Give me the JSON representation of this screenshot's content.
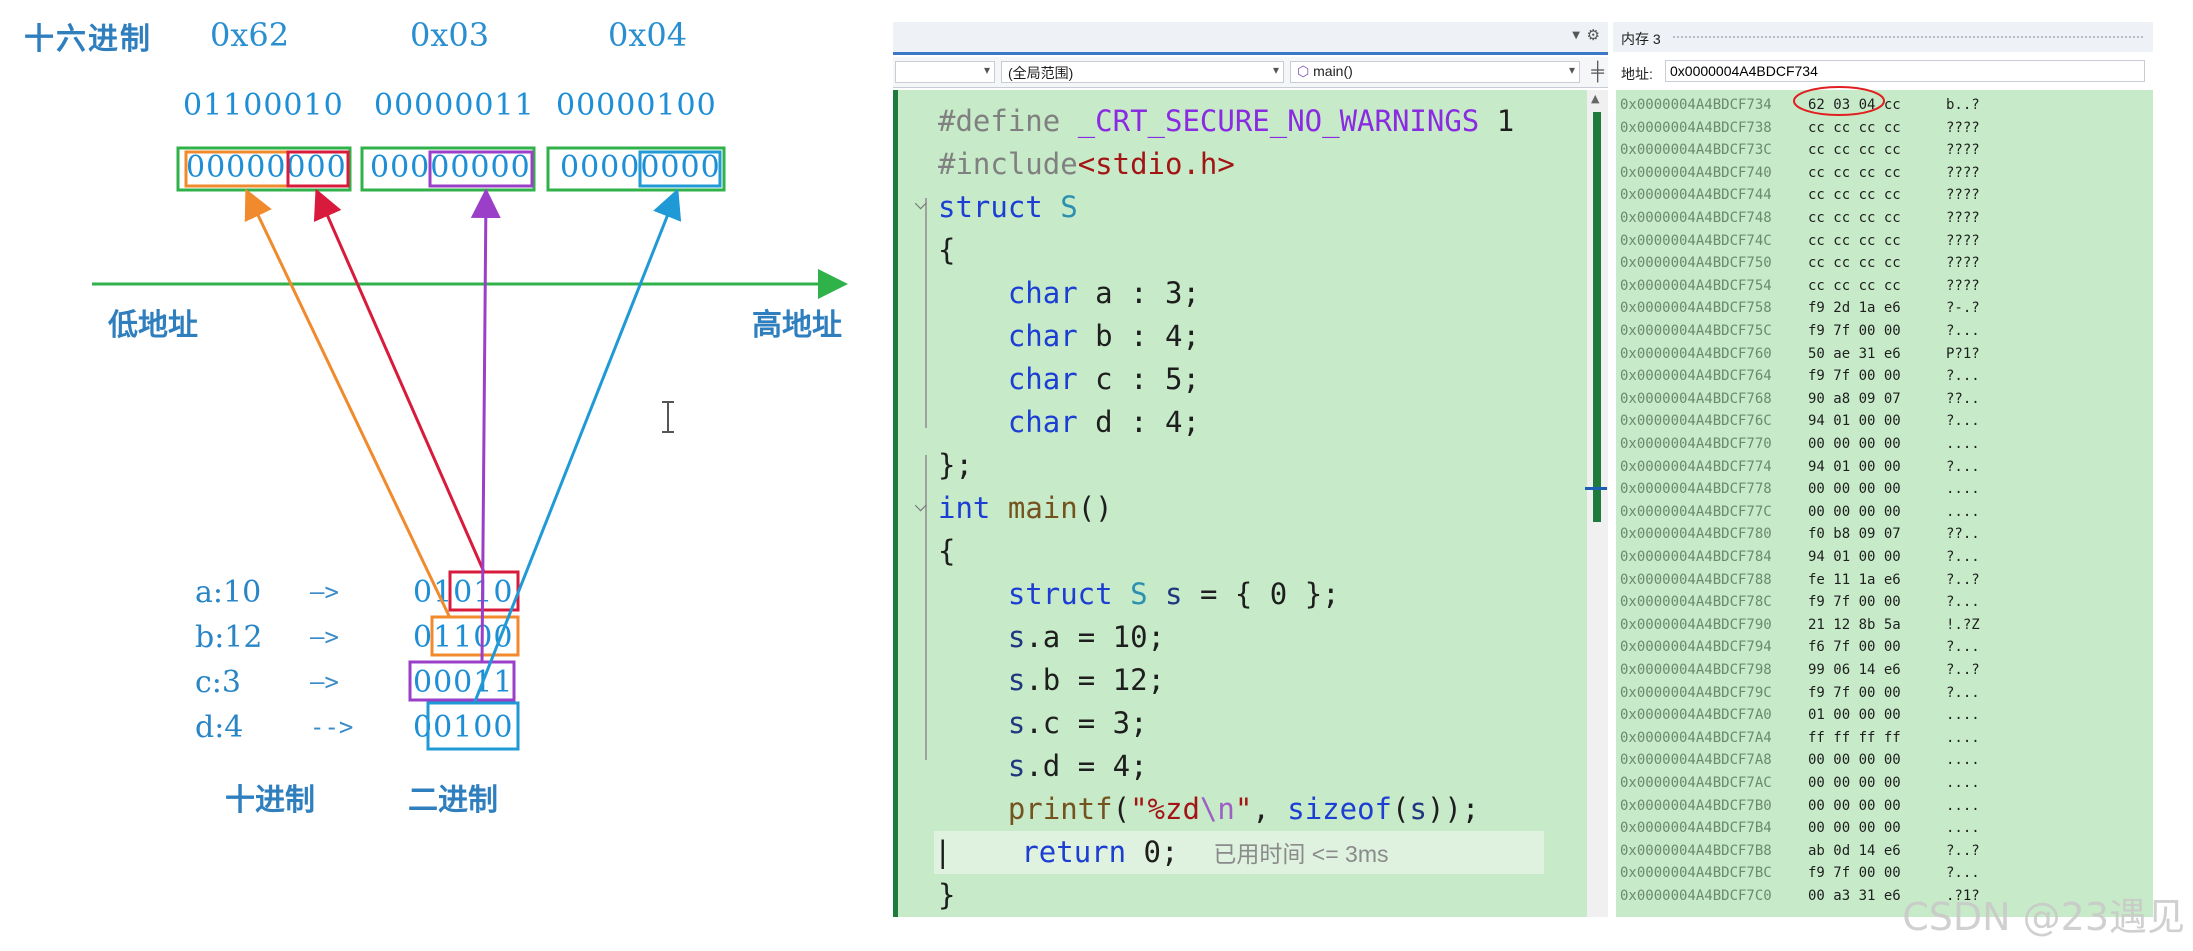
{
  "diagram": {
    "hex_label": "十六进制",
    "hex_values": [
      "0x62",
      "0x03",
      "0x04"
    ],
    "binary_values": [
      "01100010",
      "00000011",
      "00000100"
    ],
    "byte_boxes": [
      "00000000",
      "00000000",
      "00000000"
    ],
    "low_addr_label": "低地址",
    "high_addr_label": "高地址",
    "rows": [
      {
        "label": "a:10",
        "arrow": "—>",
        "bits": "01010"
      },
      {
        "label": "b:12",
        "arrow": "—>",
        "bits": "01100"
      },
      {
        "label": "c:3",
        "arrow": "—>",
        "bits": "00011"
      },
      {
        "label": "d:4",
        "arrow": "-->",
        "bits": "00100"
      }
    ],
    "decimal_label": "十进制",
    "binary_label": "二进制",
    "colors": {
      "green": "#2fb24a",
      "red": "#d81b3c",
      "orange": "#f08a2c",
      "purple": "#9b3fc8",
      "blue": "#1f9ad6"
    }
  },
  "editor": {
    "scope_dropdown": "(全局范围)",
    "function_dropdown": "main()",
    "elapsed_hint": "已用时间 <= 3ms"
  },
  "memory": {
    "title": "内存 3",
    "address_label": "地址:",
    "address_value": "0x0000004A4BDCF734",
    "rows": [
      {
        "addr": "0x0000004A4BDCF734",
        "bytes": "62 03 04 cc",
        "chars": "b..?"
      },
      {
        "addr": "0x0000004A4BDCF738",
        "bytes": "cc cc cc cc",
        "chars": "????"
      },
      {
        "addr": "0x0000004A4BDCF73C",
        "bytes": "cc cc cc cc",
        "chars": "????"
      },
      {
        "addr": "0x0000004A4BDCF740",
        "bytes": "cc cc cc cc",
        "chars": "????"
      },
      {
        "addr": "0x0000004A4BDCF744",
        "bytes": "cc cc cc cc",
        "chars": "????"
      },
      {
        "addr": "0x0000004A4BDCF748",
        "bytes": "cc cc cc cc",
        "chars": "????"
      },
      {
        "addr": "0x0000004A4BDCF74C",
        "bytes": "cc cc cc cc",
        "chars": "????"
      },
      {
        "addr": "0x0000004A4BDCF750",
        "bytes": "cc cc cc cc",
        "chars": "????"
      },
      {
        "addr": "0x0000004A4BDCF754",
        "bytes": "cc cc cc cc",
        "chars": "????"
      },
      {
        "addr": "0x0000004A4BDCF758",
        "bytes": "f9 2d 1a e6",
        "chars": "?-.?"
      },
      {
        "addr": "0x0000004A4BDCF75C",
        "bytes": "f9 7f 00 00",
        "chars": "?..."
      },
      {
        "addr": "0x0000004A4BDCF760",
        "bytes": "50 ae 31 e6",
        "chars": "P?1?"
      },
      {
        "addr": "0x0000004A4BDCF764",
        "bytes": "f9 7f 00 00",
        "chars": "?..."
      },
      {
        "addr": "0x0000004A4BDCF768",
        "bytes": "90 a8 09 07",
        "chars": "??.."
      },
      {
        "addr": "0x0000004A4BDCF76C",
        "bytes": "94 01 00 00",
        "chars": "?..."
      },
      {
        "addr": "0x0000004A4BDCF770",
        "bytes": "00 00 00 00",
        "chars": "...."
      },
      {
        "addr": "0x0000004A4BDCF774",
        "bytes": "94 01 00 00",
        "chars": "?..."
      },
      {
        "addr": "0x0000004A4BDCF778",
        "bytes": "00 00 00 00",
        "chars": "...."
      },
      {
        "addr": "0x0000004A4BDCF77C",
        "bytes": "00 00 00 00",
        "chars": "...."
      },
      {
        "addr": "0x0000004A4BDCF780",
        "bytes": "f0 b8 09 07",
        "chars": "??.."
      },
      {
        "addr": "0x0000004A4BDCF784",
        "bytes": "94 01 00 00",
        "chars": "?..."
      },
      {
        "addr": "0x0000004A4BDCF788",
        "bytes": "fe 11 1a e6",
        "chars": "?..?"
      },
      {
        "addr": "0x0000004A4BDCF78C",
        "bytes": "f9 7f 00 00",
        "chars": "?..."
      },
      {
        "addr": "0x0000004A4BDCF790",
        "bytes": "21 12 8b 5a",
        "chars": "!.?Z"
      },
      {
        "addr": "0x0000004A4BDCF794",
        "bytes": "f6 7f 00 00",
        "chars": "?..."
      },
      {
        "addr": "0x0000004A4BDCF798",
        "bytes": "99 06 14 e6",
        "chars": "?..?"
      },
      {
        "addr": "0x0000004A4BDCF79C",
        "bytes": "f9 7f 00 00",
        "chars": "?..."
      },
      {
        "addr": "0x0000004A4BDCF7A0",
        "bytes": "01 00 00 00",
        "chars": "...."
      },
      {
        "addr": "0x0000004A4BDCF7A4",
        "bytes": "ff ff ff ff",
        "chars": "...."
      },
      {
        "addr": "0x0000004A4BDCF7A8",
        "bytes": "00 00 00 00",
        "chars": "...."
      },
      {
        "addr": "0x0000004A4BDCF7AC",
        "bytes": "00 00 00 00",
        "chars": "...."
      },
      {
        "addr": "0x0000004A4BDCF7B0",
        "bytes": "00 00 00 00",
        "chars": "...."
      },
      {
        "addr": "0x0000004A4BDCF7B4",
        "bytes": "00 00 00 00",
        "chars": "...."
      },
      {
        "addr": "0x0000004A4BDCF7B8",
        "bytes": "ab 0d 14 e6",
        "chars": "?..?"
      },
      {
        "addr": "0x0000004A4BDCF7BC",
        "bytes": "f9 7f 00 00",
        "chars": "?..."
      },
      {
        "addr": "0x0000004A4BDCF7C0",
        "bytes": "00 a3 31 e6",
        "chars": ".?1?"
      }
    ]
  },
  "watermark": "CSDN @23遇见"
}
